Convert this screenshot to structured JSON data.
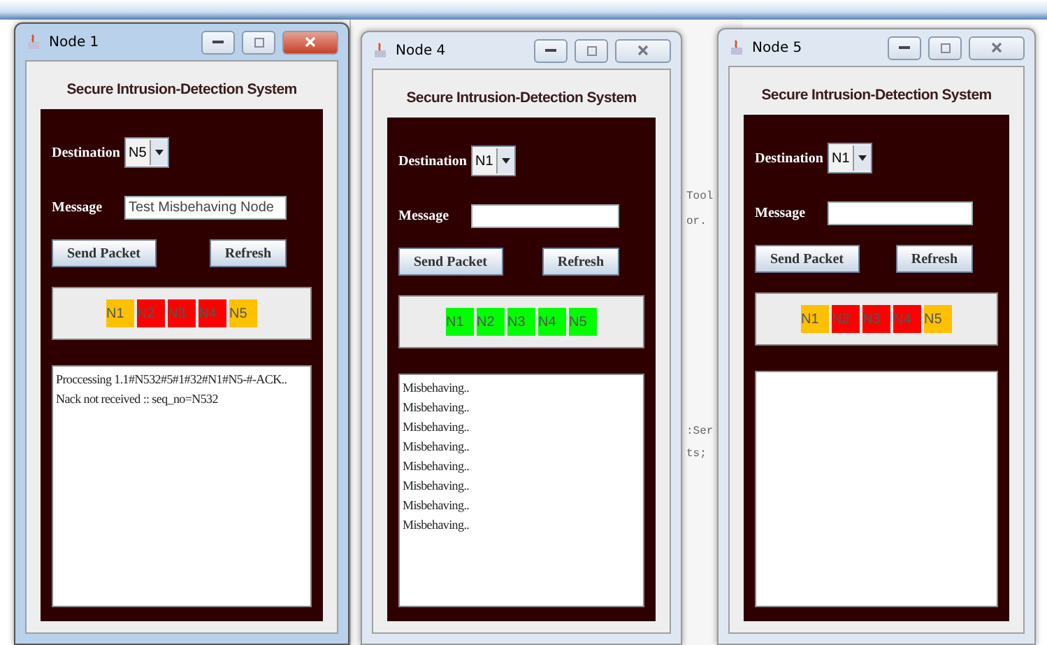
{
  "background_editor": {
    "fragments": [
      "Tool",
      "or.",
      ":Ser",
      "ts;"
    ]
  },
  "windows": [
    {
      "title": "Node 1",
      "active": true,
      "heading": "Secure Intrusion-Detection System",
      "destination_label": "Destination",
      "destination": "N5",
      "message_label": "Message",
      "message": "Test Misbehaving Node",
      "send_button": "Send Packet",
      "refresh_button": "Refresh",
      "nodes": [
        {
          "label": "N1",
          "color": "#ffc000"
        },
        {
          "label": "N2",
          "color": "#ff0000"
        },
        {
          "label": "N3",
          "color": "#ff0000"
        },
        {
          "label": "N4",
          "color": "#ff0000"
        },
        {
          "label": "N5",
          "color": "#ffc000"
        }
      ],
      "log": [
        "Proccessing 1.1#N532#5#1#32#N1#N5-#-ACK..",
        "Nack not received :: seq_no=N532"
      ]
    },
    {
      "title": "Node 4",
      "active": false,
      "heading": "Secure Intrusion-Detection System",
      "destination_label": "Destination",
      "destination": "N1",
      "message_label": "Message",
      "send_button": "Send Packet",
      "refresh_button": "Refresh",
      "nodes": [
        {
          "label": "N1",
          "color": "#00ff00"
        },
        {
          "label": "N2",
          "color": "#00ff00"
        },
        {
          "label": "N3",
          "color": "#00ff00"
        },
        {
          "label": "N4",
          "color": "#00ff00"
        },
        {
          "label": "N5",
          "color": "#00ff00"
        }
      ],
      "log": [
        "Misbehaving..",
        "Misbehaving..",
        "Misbehaving..",
        "Misbehaving..",
        "Misbehaving..",
        "Misbehaving..",
        "Misbehaving..",
        "Misbehaving.."
      ]
    },
    {
      "title": "Node 5",
      "active": false,
      "heading": "Secure Intrusion-Detection System",
      "destination_label": "Destination",
      "destination": "N1",
      "message_label": "Message",
      "send_button": "Send Packet",
      "refresh_button": "Refresh",
      "nodes": [
        {
          "label": "N1",
          "color": "#ffc000"
        },
        {
          "label": "N2",
          "color": "#ff0000"
        },
        {
          "label": "N3",
          "color": "#ff0000"
        },
        {
          "label": "N4",
          "color": "#ff0000"
        },
        {
          "label": "N5",
          "color": "#ffc000"
        }
      ]
    }
  ]
}
